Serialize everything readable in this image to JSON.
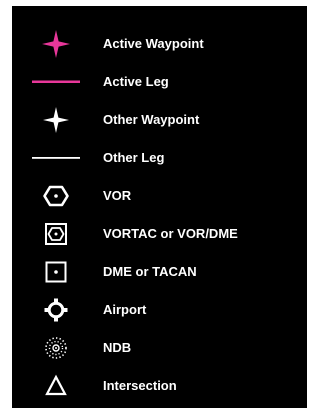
{
  "legend": {
    "colors": {
      "background": "#000000",
      "active": "#e8379a",
      "other": "#ffffff",
      "text": "#ffffff"
    },
    "items": [
      {
        "icon": "active-waypoint-star-icon",
        "label": "Active Waypoint"
      },
      {
        "icon": "active-leg-line-icon",
        "label": "Active Leg"
      },
      {
        "icon": "other-waypoint-star-icon",
        "label": "Other Waypoint"
      },
      {
        "icon": "other-leg-line-icon",
        "label": "Other Leg"
      },
      {
        "icon": "vor-hexagon-icon",
        "label": "VOR"
      },
      {
        "icon": "vortac-icon",
        "label": "VORTAC or VOR/DME"
      },
      {
        "icon": "dme-square-icon",
        "label": "DME or TACAN"
      },
      {
        "icon": "airport-icon",
        "label": "Airport"
      },
      {
        "icon": "ndb-icon",
        "label": "NDB"
      },
      {
        "icon": "intersection-triangle-icon",
        "label": "Intersection"
      }
    ]
  }
}
